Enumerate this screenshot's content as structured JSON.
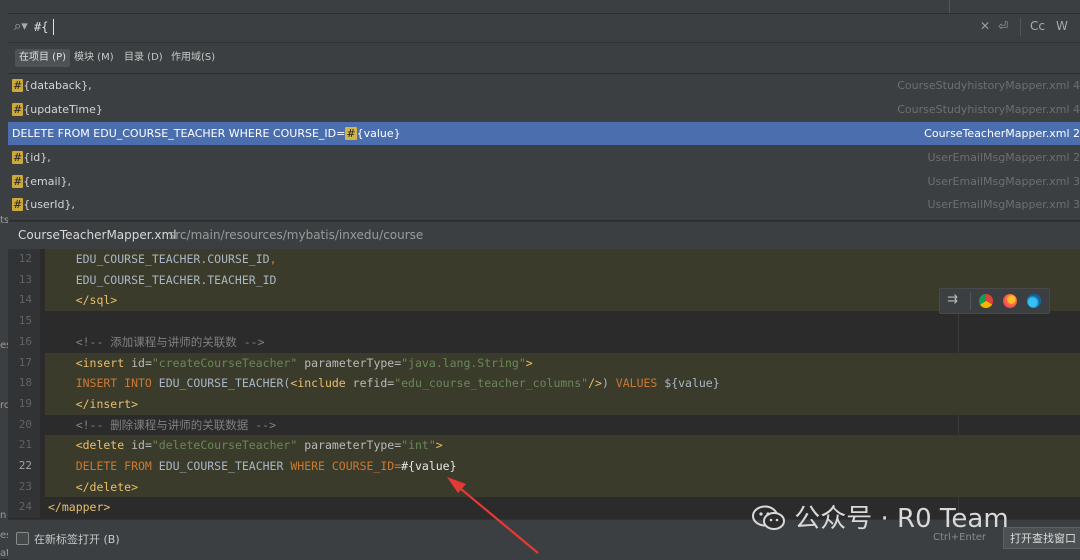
{
  "search": {
    "query": "#{"
  },
  "scopes": [
    {
      "label": "在项目 (P)",
      "active": true
    },
    {
      "label": "模块 (M)",
      "active": false
    },
    {
      "label": "目录 (D)",
      "active": false
    },
    {
      "label": "作用域(S)",
      "active": false
    }
  ],
  "toolbar": {
    "case_label": "Cc",
    "word_label": "W"
  },
  "results": [
    {
      "prefix": "",
      "hl": "#",
      "suffix": "{databack},",
      "file": "CourseStudyhistoryMapper.xml 4",
      "selected": false
    },
    {
      "prefix": "",
      "hl": "#",
      "suffix": "{updateTime}",
      "file": "CourseStudyhistoryMapper.xml 4",
      "selected": false
    },
    {
      "prefix": "DELETE FROM EDU_COURSE_TEACHER WHERE COURSE_ID=",
      "hl": "#",
      "suffix": "{value}",
      "file": "CourseTeacherMapper.xml 2",
      "selected": true
    },
    {
      "prefix": "",
      "hl": "#",
      "suffix": "{id},",
      "file": "UserEmailMsgMapper.xml 2",
      "selected": false
    },
    {
      "prefix": "",
      "hl": "#",
      "suffix": "{email},",
      "file": "UserEmailMsgMapper.xml 3",
      "selected": false
    },
    {
      "prefix": "",
      "hl": "#",
      "suffix": "{userId},",
      "file": "UserEmailMsgMapper.xml 3",
      "selected": false
    }
  ],
  "preview": {
    "file_name": "CourseTeacherMapper.xml",
    "file_path": "src/main/resources/mybatis/inxedu/course"
  },
  "code_lines": [
    {
      "n": "12",
      "band": true,
      "current": false,
      "segs": [
        [
          "plain",
          "    EDU_COURSE_TEACHER.COURSE_ID"
        ],
        [
          "kw",
          ","
        ]
      ]
    },
    {
      "n": "13",
      "band": true,
      "current": false,
      "segs": [
        [
          "plain",
          "    EDU_COURSE_TEACHER.TEACHER_ID"
        ]
      ]
    },
    {
      "n": "14",
      "band": true,
      "current": false,
      "segs": [
        [
          "tag",
          "    </sql>"
        ]
      ]
    },
    {
      "n": "15",
      "band": false,
      "current": false,
      "segs": []
    },
    {
      "n": "16",
      "band": false,
      "current": false,
      "segs": [
        [
          "cmt",
          "    <!-- 添加课程与讲师的关联数 -->"
        ]
      ]
    },
    {
      "n": "17",
      "band": true,
      "current": false,
      "segs": [
        [
          "tag",
          "    <insert "
        ],
        [
          "attr",
          "id="
        ],
        [
          "str",
          "\"createCourseTeacher\""
        ],
        [
          "attr",
          " parameterType="
        ],
        [
          "str",
          "\"java.lang.String\""
        ],
        [
          "tag",
          ">"
        ]
      ]
    },
    {
      "n": "18",
      "band": true,
      "current": false,
      "segs": [
        [
          "kw",
          "    INSERT INTO "
        ],
        [
          "plain",
          "EDU_COURSE_TEACHER("
        ],
        [
          "tag",
          "<include "
        ],
        [
          "attr",
          "refid="
        ],
        [
          "str",
          "\"edu_course_teacher_columns\""
        ],
        [
          "tag",
          "/>"
        ],
        [
          "plain",
          ") "
        ],
        [
          "kw",
          "VALUES "
        ],
        [
          "plain",
          "${value}"
        ]
      ]
    },
    {
      "n": "19",
      "band": true,
      "current": false,
      "segs": [
        [
          "tag",
          "    </insert>"
        ]
      ]
    },
    {
      "n": "20",
      "band": false,
      "current": false,
      "segs": [
        [
          "cmt",
          "    <!-- 删除课程与讲师的关联数据 -->"
        ]
      ]
    },
    {
      "n": "21",
      "band": true,
      "current": false,
      "segs": [
        [
          "tag",
          "    <delete "
        ],
        [
          "attr",
          "id="
        ],
        [
          "str",
          "\"deleteCourseTeacher\""
        ],
        [
          "attr",
          " parameterType="
        ],
        [
          "str",
          "\"int\""
        ],
        [
          "tag",
          ">"
        ]
      ]
    },
    {
      "n": "22",
      "band": true,
      "current": true,
      "segs": [
        [
          "kw",
          "    DELETE FROM "
        ],
        [
          "plain",
          "EDU_COURSE_TEACHER "
        ],
        [
          "kw",
          "WHERE COURSE_ID="
        ],
        [
          "bright",
          "#{value}"
        ]
      ]
    },
    {
      "n": "23",
      "band": true,
      "current": false,
      "segs": [
        [
          "tag",
          "    </delete>"
        ]
      ]
    },
    {
      "n": "24",
      "band": false,
      "current": false,
      "segs": [
        [
          "tag",
          "</mapper>"
        ]
      ]
    }
  ],
  "bottom": {
    "newtab_label": "在新标签打开 (B)",
    "shortcut": "Ctrl+Enter",
    "open_button": "打开查找窗口"
  },
  "watermark": {
    "text": "公众号 · R0 Team"
  },
  "colors": {
    "selection": "#4b6eaf",
    "match_highlight": "#ccaa3a",
    "arrow": "#e53935"
  }
}
